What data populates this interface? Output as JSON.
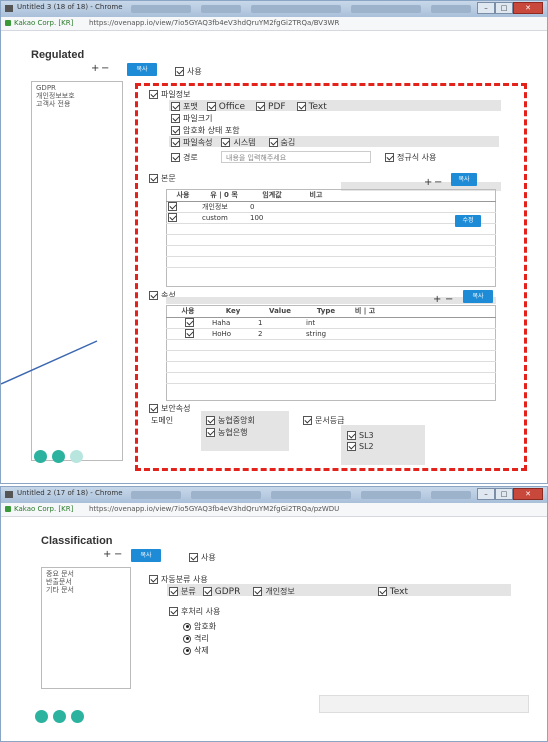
{
  "colors": {
    "accent": "#1e8bd6",
    "highlight_border": "#e3231b",
    "gray_bar": "#e4e4e4",
    "nav_circle": "#2bb3a0"
  },
  "win1": {
    "title": "Untitled 3 (18 of 18) - Chrome",
    "site": "Kakao Corp. [KR]",
    "url": "https://ovenapp.io/view/7io5GYAQ3fb4eV3hdQruYM2fgGi2TRQa/BV3WR",
    "heading": "Regulated",
    "plus": "+",
    "minus": "−",
    "copy_btn": "복사",
    "use_label": "사용",
    "list_items": [
      "GDPR",
      "개인정보보호",
      "고객사 전용"
    ],
    "file_info": {
      "title": "파일정보",
      "format_label": "포맷",
      "formats": [
        "Office",
        "PDF",
        "Text"
      ],
      "size": "파일크기",
      "encryption": "암호화 상태 포함",
      "attr_label": "파일속성",
      "attr_opts": [
        "시스템",
        "숨김"
      ],
      "path_label": "경로",
      "path_placeholder": "내용을 입력해주세요",
      "regex": "정규식 사용"
    },
    "body_section": {
      "title": "본문",
      "copy_btn": "복사",
      "edit_btn": "수정",
      "headers": [
        "사용",
        "유 | 0 목",
        "임계값",
        "비고"
      ],
      "rows": [
        {
          "item": "개인정보",
          "threshold": "0",
          "note": ""
        },
        {
          "item": "custom",
          "threshold": "100",
          "note": ""
        }
      ]
    },
    "attr_section": {
      "title": "속성",
      "copy_btn": "복사",
      "headers": [
        "사용",
        "Key",
        "Value",
        "Type",
        "비 | 고"
      ],
      "rows": [
        {
          "key": "Haha",
          "value": "1",
          "type": "int"
        },
        {
          "key": "HoHo",
          "value": "2",
          "type": "string"
        }
      ]
    },
    "security": {
      "title": "보안속성",
      "domain_label": "도메인",
      "domains": [
        "농협중앙회",
        "농협은행"
      ],
      "grade_label": "문서등급",
      "grades": [
        "SL3",
        "SL2"
      ]
    }
  },
  "win2": {
    "title": "Untitled 2 (17 of 18) - Chrome",
    "site": "Kakao Corp. [KR]",
    "url": "https://ovenapp.io/view/7io5GYAQ3fb4eV3hdQruYM2fgGi2TRQa/pzWDU",
    "heading": "Classification",
    "plus": "+",
    "minus": "−",
    "copy_btn": "복사",
    "use_label": "사용",
    "list_items": [
      "중요 문서",
      "반출문서",
      "기타 문서"
    ],
    "auto_label": "자동분류 사용",
    "cat_label": "분류",
    "cats": [
      "GDPR",
      "개인정보",
      "Text"
    ],
    "post_label": "후처리 사용",
    "post_opts": [
      "암호화",
      "격리",
      "삭제"
    ]
  }
}
